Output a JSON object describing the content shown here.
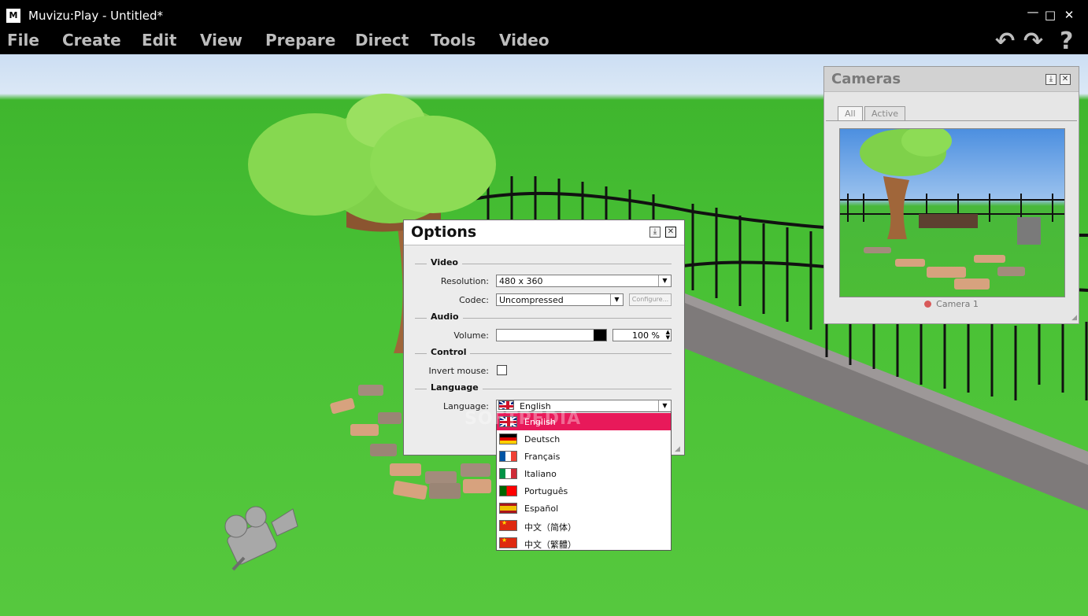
{
  "window": {
    "title": "Muvizu:Play - Untitled*",
    "logo": "M",
    "minimize_icon": "minimize-icon",
    "maximize_icon": "maximize-icon",
    "close_icon": "close-icon"
  },
  "menu": {
    "items": [
      "File",
      "Create",
      "Edit",
      "View",
      "Prepare",
      "Direct",
      "Tools",
      "Video"
    ],
    "undo_icon": "↶",
    "redo_icon": "↷",
    "help_icon": "?"
  },
  "cameras_panel": {
    "title": "Cameras",
    "tabs": [
      "All",
      "Active"
    ],
    "active_tab": "All",
    "camera_label": "Camera 1",
    "pin_icon": "pin-icon",
    "close_icon": "close-icon"
  },
  "options_dialog": {
    "title": "Options",
    "sections": {
      "video": "Video",
      "audio": "Audio",
      "control": "Control",
      "language": "Language"
    },
    "labels": {
      "resolution": "Resolution:",
      "codec": "Codec:",
      "volume": "Volume:",
      "invert_mouse": "Invert mouse:",
      "language": "Language:"
    },
    "values": {
      "resolution": "480 x 360",
      "codec": "Uncompressed",
      "configure": "Configure...",
      "volume": "100 %",
      "volume_fraction": 1.0,
      "invert_mouse": false,
      "language": "English"
    }
  },
  "language_options": [
    {
      "label": "English",
      "flag": "flag-uk"
    },
    {
      "label": "Deutsch",
      "flag": "flag-de"
    },
    {
      "label": "Français",
      "flag": "flag-fr"
    },
    {
      "label": "Italiano",
      "flag": "flag-it"
    },
    {
      "label": "Português",
      "flag": "flag-pt"
    },
    {
      "label": "Español",
      "flag": "flag-es"
    },
    {
      "label": "中文（简体）",
      "flag": "flag-cn"
    },
    {
      "label": "中文（繁體）",
      "flag": "flag-cn"
    }
  ],
  "watermark": "SOFTPEDIA",
  "colors": {
    "selection": "#e8195a",
    "grass": "#49c135",
    "titlebar": "#000000"
  }
}
